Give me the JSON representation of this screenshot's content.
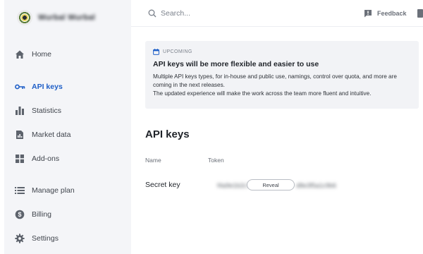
{
  "brand": {
    "name": "Wurbal Wurbal",
    "logo_icon": "brand-logo"
  },
  "sidebar": {
    "items": [
      {
        "label": "Home",
        "icon": "home-icon",
        "active": false
      },
      {
        "label": "API keys",
        "icon": "key-icon",
        "active": true
      },
      {
        "label": "Statistics",
        "icon": "bar-chart-icon",
        "active": false
      },
      {
        "label": "Market data",
        "icon": "document-chart-icon",
        "active": false
      },
      {
        "label": "Add-ons",
        "icon": "grid-plus-icon",
        "active": false
      },
      {
        "label": "Manage plan",
        "icon": "list-icon",
        "active": false
      },
      {
        "label": "Billing",
        "icon": "dollar-icon",
        "active": false
      },
      {
        "label": "Settings",
        "icon": "gear-icon",
        "active": false
      }
    ]
  },
  "topbar": {
    "search_placeholder": "Search...",
    "feedback_label": "Feedback"
  },
  "banner": {
    "tag": "UPCOMING",
    "title": "API keys will be more flexible and easier to use",
    "line1": "Multiple API keys types, for in-house and public use, namings, control over quota, and more are coming in the next releases.",
    "line2": "The updated experience will make the work across the team more fluent and intuitive."
  },
  "main": {
    "title": "API keys",
    "columns": [
      "Name",
      "Token"
    ],
    "rows": [
      {
        "name": "Secret key",
        "token_left": "f4a9e1b2c7",
        "token_right": "d8e3f5a1c9b6",
        "reveal_label": "Reveal"
      }
    ]
  },
  "colors": {
    "accent": "#1f5fc7",
    "sidebar_bg": "#f4f5f8",
    "banner_bg": "#f2f3f6"
  }
}
